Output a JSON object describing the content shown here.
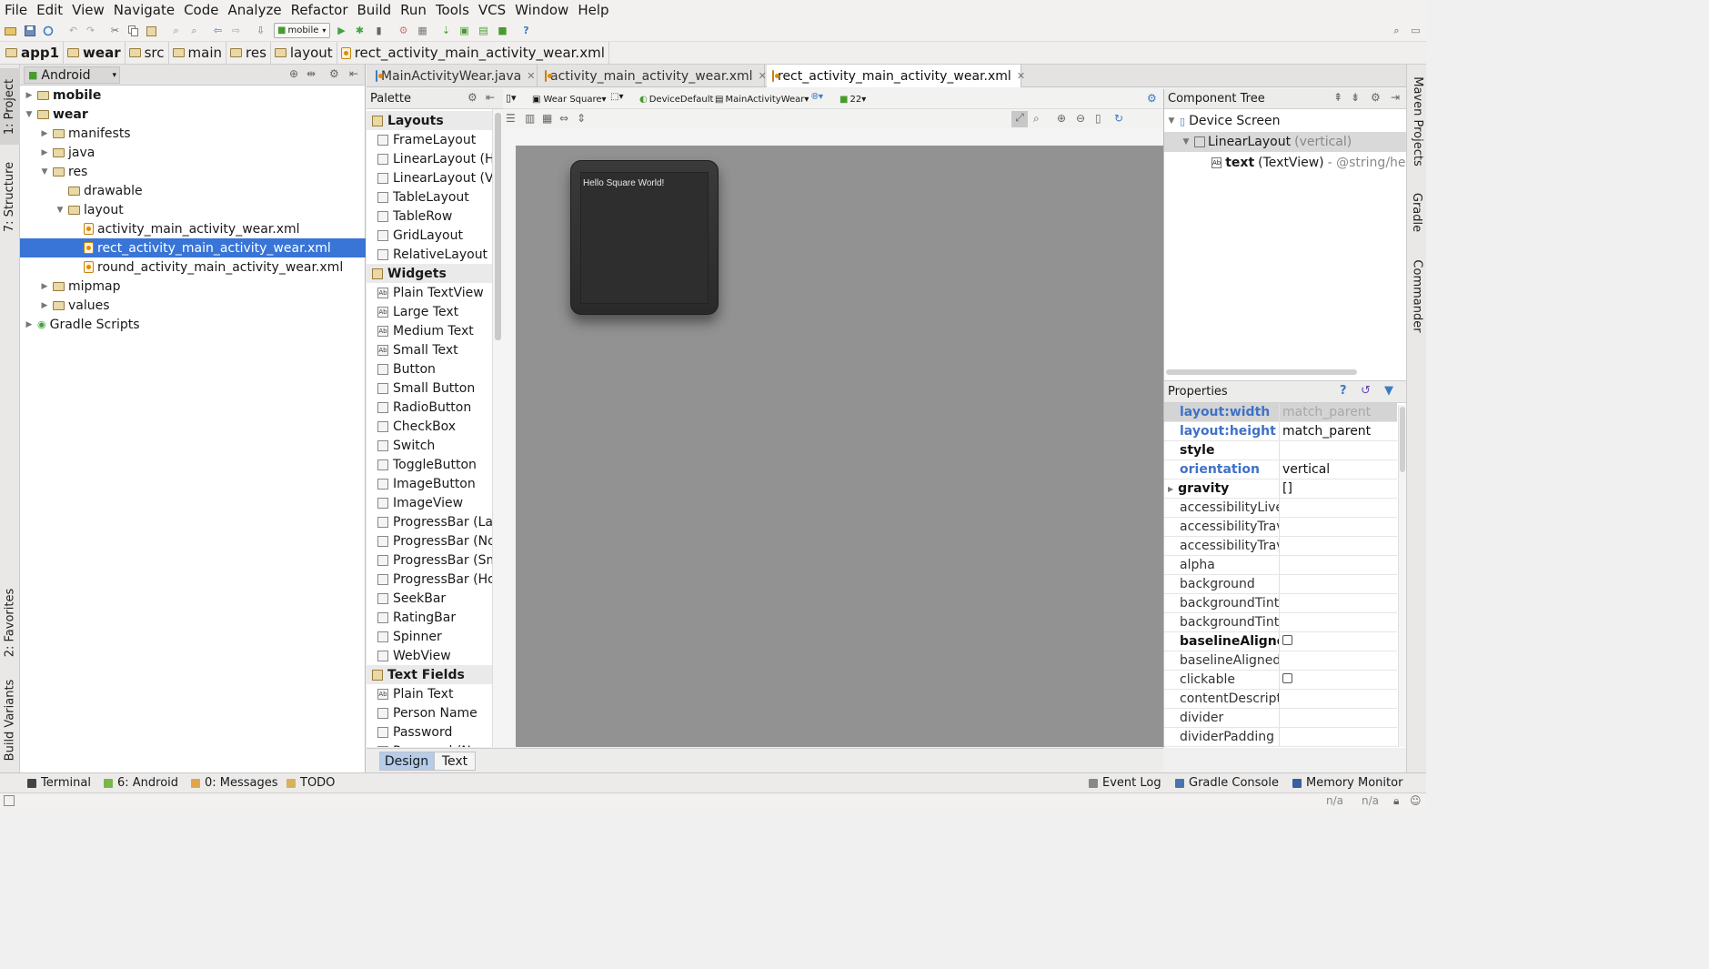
{
  "menu": [
    "File",
    "Edit",
    "View",
    "Navigate",
    "Code",
    "Analyze",
    "Refactor",
    "Build",
    "Run",
    "Tools",
    "VCS",
    "Window",
    "Help"
  ],
  "toolbar": {
    "run_config": "mobile"
  },
  "breadcrumbs": [
    "app1",
    "wear",
    "src",
    "main",
    "res",
    "layout",
    "rect_activity_main_activity_wear.xml"
  ],
  "left_tool_tabs": {
    "project": "1: Project",
    "structure": "7: Structure",
    "favorites": "2: Favorites",
    "build_variants": "Build Variants"
  },
  "right_tool_tabs": {
    "maven": "Maven Projects",
    "gradle": "Gradle",
    "commander": "Commander"
  },
  "project_panel": {
    "view_mode": "Android",
    "tree": [
      {
        "label": "mobile",
        "bold": true
      },
      {
        "label": "wear",
        "bold": true
      },
      {
        "label": "manifests"
      },
      {
        "label": "java"
      },
      {
        "label": "res"
      },
      {
        "label": "drawable"
      },
      {
        "label": "layout"
      },
      {
        "label": "activity_main_activity_wear.xml"
      },
      {
        "label": "rect_activity_main_activity_wear.xml",
        "selected": true
      },
      {
        "label": "round_activity_main_activity_wear.xml"
      },
      {
        "label": "mipmap"
      },
      {
        "label": "values"
      },
      {
        "label": "Gradle Scripts"
      }
    ]
  },
  "editor_tabs": [
    "MainActivityWear.java",
    "activity_main_activity_wear.xml",
    "rect_activity_main_activity_wear.xml"
  ],
  "palette": {
    "title": "Palette",
    "items": [
      {
        "label": "Layouts",
        "cat": true
      },
      {
        "label": "FrameLayout"
      },
      {
        "label": "LinearLayout (Ho"
      },
      {
        "label": "LinearLayout (Ve"
      },
      {
        "label": "TableLayout"
      },
      {
        "label": "TableRow"
      },
      {
        "label": "GridLayout"
      },
      {
        "label": "RelativeLayout"
      },
      {
        "label": "Widgets",
        "cat": true
      },
      {
        "label": "Plain TextView"
      },
      {
        "label": "Large Text"
      },
      {
        "label": "Medium Text"
      },
      {
        "label": "Small Text"
      },
      {
        "label": "Button"
      },
      {
        "label": "Small Button"
      },
      {
        "label": "RadioButton"
      },
      {
        "label": "CheckBox"
      },
      {
        "label": "Switch"
      },
      {
        "label": "ToggleButton"
      },
      {
        "label": "ImageButton"
      },
      {
        "label": "ImageView"
      },
      {
        "label": "ProgressBar (Lar"
      },
      {
        "label": "ProgressBar (No"
      },
      {
        "label": "ProgressBar (Sm"
      },
      {
        "label": "ProgressBar (Ho"
      },
      {
        "label": "SeekBar"
      },
      {
        "label": "RatingBar"
      },
      {
        "label": "Spinner"
      },
      {
        "label": "WebView"
      },
      {
        "label": "Text Fields",
        "cat": true
      },
      {
        "label": "Plain Text"
      },
      {
        "label": "Person Name"
      },
      {
        "label": "Password"
      },
      {
        "label": "Password (Nume"
      }
    ]
  },
  "design_toolbar": {
    "device": "Wear Square",
    "theme": "DeviceDefault",
    "activity": "MainActivityWear",
    "api": "22"
  },
  "preview": {
    "text": "Hello Square World!"
  },
  "bottom_tabs": {
    "design": "Design",
    "text": "Text"
  },
  "component_tree": {
    "title": "Component Tree",
    "root": "Device Screen",
    "layout": "LinearLayout",
    "layout_hint": "(vertical)",
    "text_id": "text",
    "text_type": "(TextView)",
    "text_value": "- @string/hell"
  },
  "properties": {
    "title": "Properties",
    "rows": [
      {
        "name": "layout:width",
        "value": "match_parent",
        "style": "blue",
        "dim": true
      },
      {
        "name": "layout:height",
        "value": "match_parent",
        "style": "blue"
      },
      {
        "name": "style",
        "value": "",
        "style": "bold"
      },
      {
        "name": "orientation",
        "value": "vertical",
        "style": "blue"
      },
      {
        "name": "gravity",
        "value": "[]",
        "style": "bold"
      },
      {
        "name": "accessibilityLiveR",
        "value": ""
      },
      {
        "name": "accessibilityTrave",
        "value": ""
      },
      {
        "name": "accessibilityTrave",
        "value": ""
      },
      {
        "name": "alpha",
        "value": ""
      },
      {
        "name": "background",
        "value": ""
      },
      {
        "name": "backgroundTint",
        "value": ""
      },
      {
        "name": "backgroundTintM",
        "value": ""
      },
      {
        "name": "baselineAligned",
        "value": "",
        "style": "bold",
        "checkbox": true
      },
      {
        "name": "baselineAlignedC",
        "value": ""
      },
      {
        "name": "clickable",
        "value": "",
        "checkbox": true
      },
      {
        "name": "contentDescript",
        "value": ""
      },
      {
        "name": "divider",
        "value": ""
      },
      {
        "name": "dividerPadding",
        "value": ""
      }
    ]
  },
  "status_tools_left": [
    {
      "label": "Terminal"
    },
    {
      "label": "6: Android"
    },
    {
      "label": "0: Messages"
    },
    {
      "label": "TODO"
    }
  ],
  "status_tools_right": [
    {
      "label": "Event Log"
    },
    {
      "label": "Gradle Console"
    },
    {
      "label": "Memory Monitor"
    }
  ],
  "footer": {
    "pos1": "n/a",
    "pos2": "n/a"
  },
  "colors": {
    "selection": "#3875d7",
    "canvas": "#929292",
    "accent_blue": "#3f72c7"
  }
}
